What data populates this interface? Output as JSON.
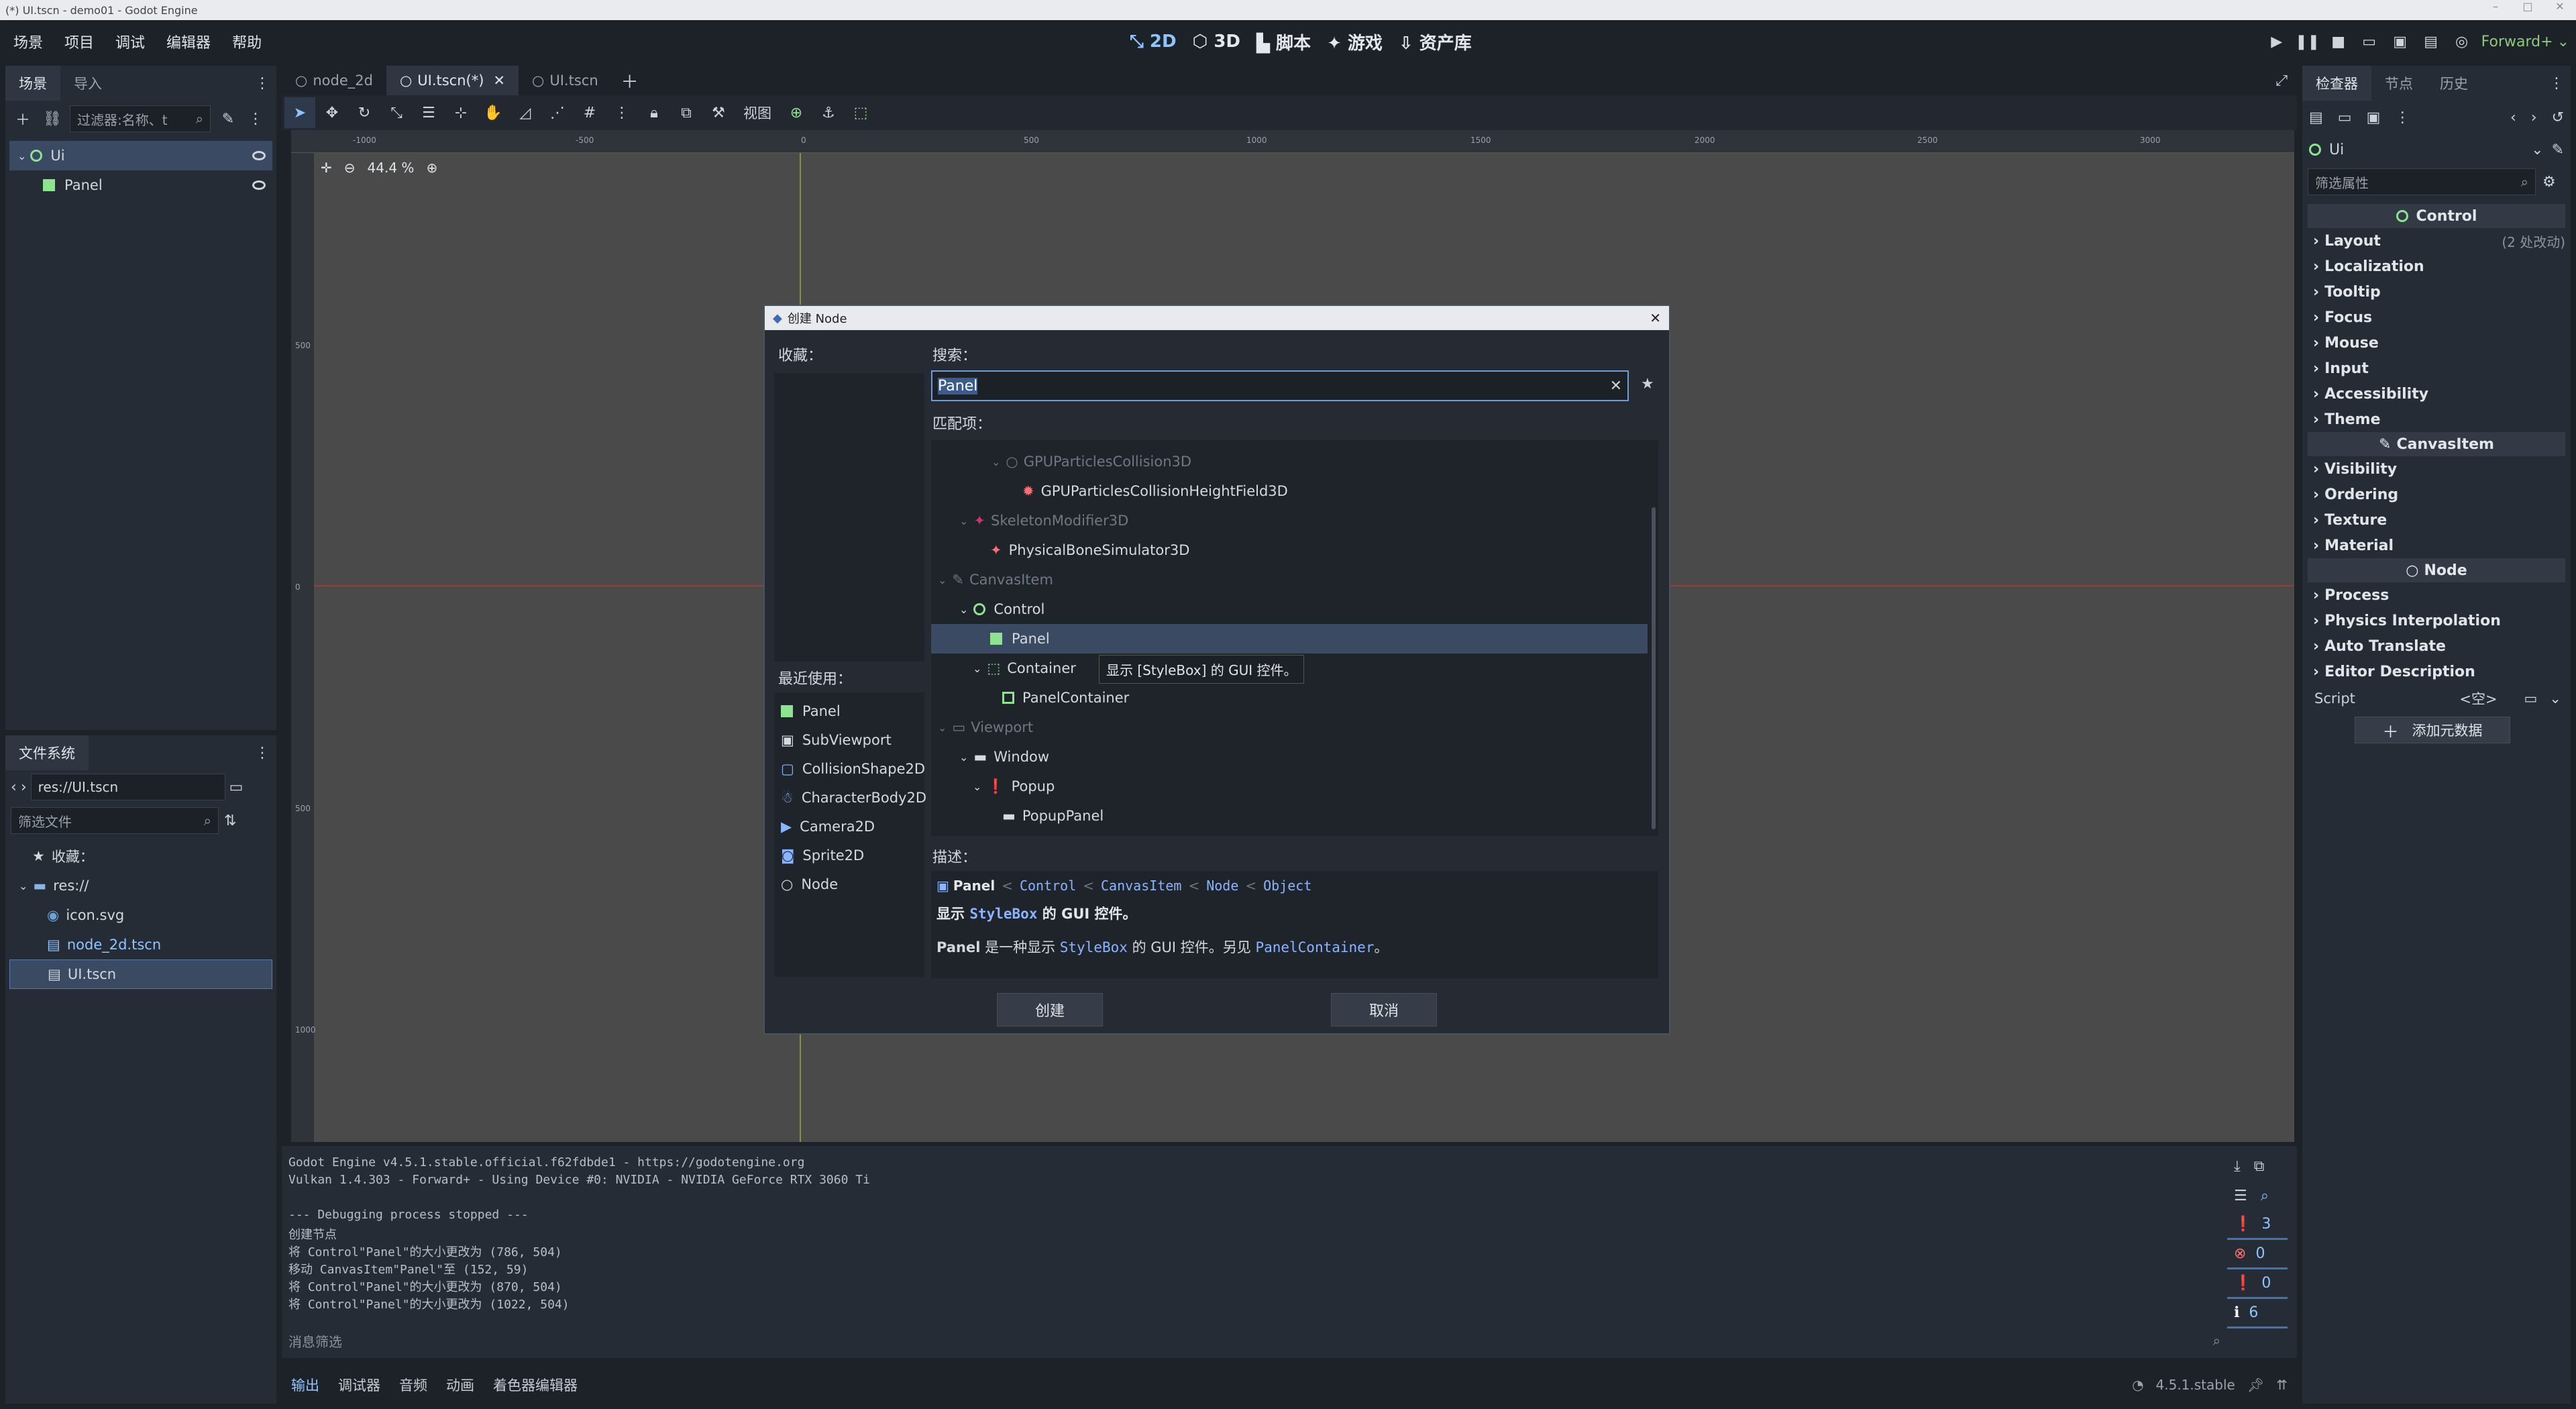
{
  "window": {
    "title": "(*) UI.tscn - demo01 - Godot Engine",
    "controls": [
      "–",
      "□",
      "✕"
    ]
  },
  "menu": [
    "场景",
    "项目",
    "调试",
    "编辑器",
    "帮助"
  ],
  "main_screens": [
    {
      "label": "2D",
      "active": true
    },
    {
      "label": "3D"
    },
    {
      "label": "脚本"
    },
    {
      "label": "游戏"
    },
    {
      "label": "资产库"
    }
  ],
  "renderer": "Forward+",
  "scene_dock": {
    "tabs": [
      "场景",
      "导入"
    ],
    "filter_placeholder": "过滤器:名称、t",
    "tree": [
      {
        "name": "Ui",
        "type": "Control"
      },
      {
        "name": "Panel",
        "type": "Panel"
      }
    ]
  },
  "filesystem_dock": {
    "title": "文件系统",
    "path": "res://UI.tscn",
    "filter_placeholder": "筛选文件",
    "items": [
      {
        "label": "收藏：",
        "kind": "favorites"
      },
      {
        "label": "res://",
        "kind": "folder"
      },
      {
        "label": "icon.svg",
        "kind": "file"
      },
      {
        "label": "node_2d.tscn",
        "kind": "scene"
      },
      {
        "label": "UI.tscn",
        "kind": "scene",
        "selected": true
      }
    ]
  },
  "editor_tabs": [
    {
      "label": "node_2d"
    },
    {
      "label": "UI.tscn(*)",
      "active": true
    },
    {
      "label": "UI.tscn"
    }
  ],
  "toolbar": {
    "view_label": "视图"
  },
  "viewport": {
    "zoom": "44.4 %",
    "ruler_labels": [
      "-1000",
      "-500",
      "0",
      "500",
      "1000",
      "1500",
      "2000",
      "2500",
      "3000"
    ],
    "vruler_labels": [
      "500",
      "0",
      "500",
      "1000"
    ]
  },
  "dialog": {
    "title": "创建 Node",
    "favorites_label": "收藏：",
    "search_label": "搜索：",
    "search_value": "Panel",
    "matches_label": "匹配项：",
    "matches": [
      {
        "label": "GPUParticlesCollision3D",
        "indent": 1,
        "dim": true,
        "icon": "circle"
      },
      {
        "label": "GPUParticlesCollisionHeightField3D",
        "indent": 2,
        "icon": "particle"
      },
      {
        "label": "SkeletonModifier3D",
        "indent": 1,
        "dim": true,
        "icon": "bone"
      },
      {
        "label": "PhysicalBoneSimulator3D",
        "indent": 2,
        "icon": "bone"
      },
      {
        "label": "CanvasItem",
        "indent": 0,
        "dim": true,
        "icon": "pencil"
      },
      {
        "label": "Control",
        "indent": 1,
        "icon": "circle"
      },
      {
        "label": "Panel",
        "indent": 2,
        "icon": "square",
        "selected": true
      },
      {
        "label": "Container",
        "indent": 2,
        "icon": "dashed"
      },
      {
        "label": "PanelContainer",
        "indent": 3,
        "icon": "outline"
      },
      {
        "label": "Viewport",
        "indent": 0,
        "dim": true,
        "icon": "viewport"
      },
      {
        "label": "Window",
        "indent": 1,
        "icon": "window"
      },
      {
        "label": "Popup",
        "indent": 2,
        "icon": "popup"
      },
      {
        "label": "PopupPanel",
        "indent": 3,
        "icon": "window"
      }
    ],
    "tooltip": "显示 [StyleBox] 的 GUI 控件。",
    "recent_label": "最近使用：",
    "recent": [
      "Panel",
      "SubViewport",
      "CollisionShape2D",
      "CharacterBody2D",
      "Camera2D",
      "Sprite2D",
      "Node"
    ],
    "description_label": "描述：",
    "desc_class": "Panel",
    "desc_chain": [
      "Control",
      "CanvasItem",
      "Node",
      "Object"
    ],
    "desc_short": {
      "pre": "显示 ",
      "code": "StyleBox",
      "post": " 的 GUI 控件。"
    },
    "desc_long": {
      "bold": "Panel",
      "mid": " 是一种显示 ",
      "code": "StyleBox",
      "mid2": " 的 GUI 控件。另见 ",
      "code2": "PanelContainer",
      "end": "。"
    },
    "create_button": "创建",
    "cancel_button": "取消"
  },
  "output": {
    "lines": [
      "Godot Engine v4.5.1.stable.official.f62fdbde1 - https://godotengine.org",
      "Vulkan 1.4.303 - Forward+ - Using Device #0: NVIDIA - NVIDIA GeForce RTX 3060 Ti",
      "",
      "--- Debugging process stopped ---",
      "创建节点",
      "将 Control\"Panel\"的大小更改为 (786, 504)",
      "移动 CanvasItem\"Panel\"至 (152, 59)",
      "将 Control\"Panel\"的大小更改为 (870, 504)",
      "将 Control\"Panel\"的大小更改为 (1022, 504)"
    ],
    "filter_placeholder": "消息筛选",
    "counts": {
      "messages": "3",
      "errors": "0",
      "warnings": "0",
      "info": "6"
    }
  },
  "bottom_tabs": [
    "输出",
    "调试器",
    "音频",
    "动画",
    "着色器编辑器"
  ],
  "version": "4.5.1.stable",
  "inspector": {
    "tabs": [
      "检查器",
      "节点",
      "历史"
    ],
    "node_name": "Ui",
    "filter_placeholder": "筛选属性",
    "sections": [
      {
        "header": "Control",
        "items": [
          {
            "label": "Layout",
            "note": "(2 处改动)"
          },
          {
            "label": "Localization"
          },
          {
            "label": "Tooltip"
          },
          {
            "label": "Focus"
          },
          {
            "label": "Mouse"
          },
          {
            "label": "Input"
          },
          {
            "label": "Accessibility"
          },
          {
            "label": "Theme"
          }
        ]
      },
      {
        "header": "CanvasItem",
        "items": [
          {
            "label": "Visibility"
          },
          {
            "label": "Ordering"
          },
          {
            "label": "Texture"
          },
          {
            "label": "Material"
          }
        ]
      },
      {
        "header": "Node",
        "items": [
          {
            "label": "Process"
          },
          {
            "label": "Physics Interpolation"
          },
          {
            "label": "Auto Translate"
          },
          {
            "label": "Editor Description"
          }
        ]
      }
    ],
    "script_label": "Script",
    "script_value": "<空>",
    "add_metadata": "添加元数据"
  },
  "colors": {
    "accent": "#8ec5ff",
    "selection": "#3a4a62",
    "panel": "#262c35",
    "bg": "#1d2229",
    "viewport": "#4a4a4a",
    "node_green": "#8de38f"
  }
}
